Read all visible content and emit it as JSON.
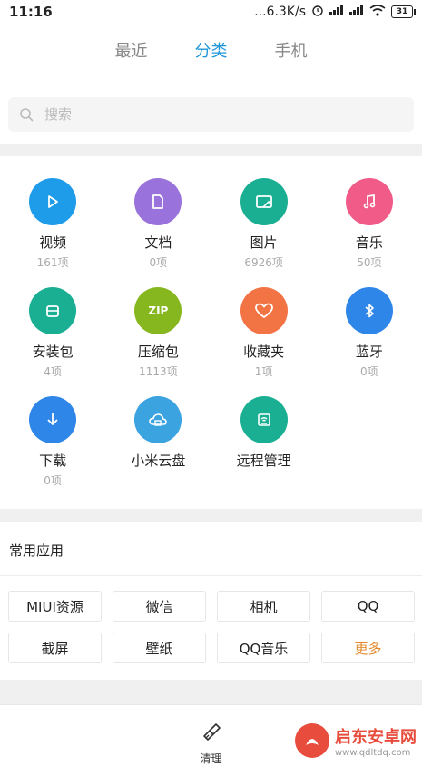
{
  "status_bar": {
    "time": "11:16",
    "network_speed": "...6.3K/s",
    "battery": "31"
  },
  "tabs": [
    {
      "label": "最近",
      "active": false
    },
    {
      "label": "分类",
      "active": true
    },
    {
      "label": "手机",
      "active": false
    }
  ],
  "search": {
    "placeholder": "搜索"
  },
  "categories": [
    {
      "label": "视频",
      "count": "161项",
      "icon": "play-icon",
      "color": "#1e9be9"
    },
    {
      "label": "文档",
      "count": "0项",
      "icon": "document-icon",
      "color": "#9a72db"
    },
    {
      "label": "图片",
      "count": "6926项",
      "icon": "image-icon",
      "color": "#1aaf93"
    },
    {
      "label": "音乐",
      "count": "50项",
      "icon": "music-icon",
      "color": "#f05b88"
    },
    {
      "label": "安装包",
      "count": "4项",
      "icon": "package-icon",
      "color": "#1aaf93"
    },
    {
      "label": "压缩包",
      "count": "1113项",
      "icon": "zip-icon",
      "color": "#86b71e"
    },
    {
      "label": "收藏夹",
      "count": "1项",
      "icon": "heart-icon",
      "color": "#f27444"
    },
    {
      "label": "蓝牙",
      "count": "0项",
      "icon": "bluetooth-icon",
      "color": "#2f86e9"
    },
    {
      "label": "下载",
      "count": "0项",
      "icon": "download-icon",
      "color": "#2f86e9"
    },
    {
      "label": "小米云盘",
      "count": "",
      "icon": "cloud-icon",
      "color": "#3aa3e0"
    },
    {
      "label": "远程管理",
      "count": "",
      "icon": "remote-icon",
      "color": "#1aaf93"
    }
  ],
  "zip_text": "ZIP",
  "common_apps": {
    "title": "常用应用",
    "items": [
      "MIUI资源",
      "微信",
      "相机",
      "QQ",
      "截屏",
      "壁纸",
      "QQ音乐",
      "更多"
    ]
  },
  "bottom": {
    "clean_label": "清理"
  },
  "watermark": {
    "title": "启东安卓网",
    "url": "www.qdltdq.com"
  }
}
